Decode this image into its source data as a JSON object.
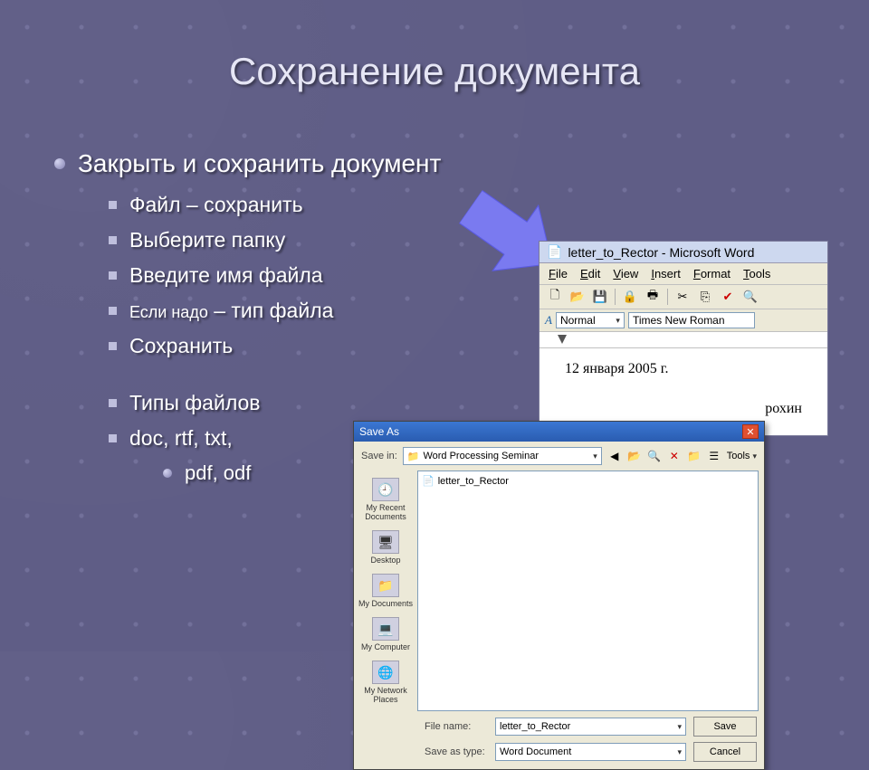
{
  "title": "Сохранение документа",
  "main_bullet": "Закрыть и сохранить документ",
  "sub_items": {
    "a": "Файл – сохранить",
    "b": "Выберите папку",
    "c": "Введите имя файла",
    "d_lead": "Если надо",
    "d_rest": " – тип файла",
    "e": "Сохранить",
    "f": "Типы файлов",
    "g": "doc, rtf, txt,"
  },
  "sub_sub": "pdf, odf",
  "word": {
    "title": "letter_to_Rector - Microsoft Word",
    "menu": {
      "file": "File",
      "edit": "Edit",
      "view": "View",
      "insert": "Insert",
      "format": "Format",
      "tools": "Tools"
    },
    "style_label": "Normal",
    "font": "Times New Roman",
    "date": "12 января 2005 г.",
    "name": "рохин"
  },
  "saveas": {
    "title": "Save As",
    "savein_label": "Save in:",
    "savein_value": "Word Processing Seminar",
    "tools": "Tools",
    "list_item": "letter_to_Rector",
    "places": {
      "recent": "My Recent Documents",
      "desktop": "Desktop",
      "mydocs": "My Documents",
      "mycomp": "My Computer",
      "mynet": "My Network Places"
    },
    "filename_label": "File name:",
    "filename_value": "letter_to_Rector",
    "savetype_label": "Save as type:",
    "savetype_value": "Word Document",
    "save_btn": "Save",
    "cancel_btn": "Cancel"
  }
}
